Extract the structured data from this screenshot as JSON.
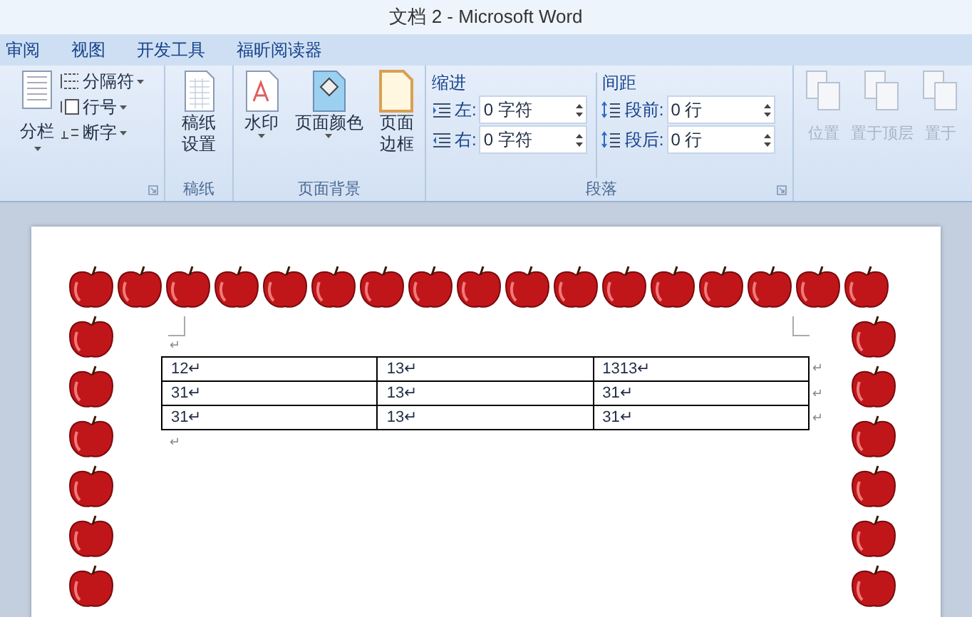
{
  "window": {
    "title": "文档 2 - Microsoft Word"
  },
  "tabs": [
    {
      "label": "审阅",
      "selected": false
    },
    {
      "label": "视图",
      "selected": false
    },
    {
      "label": "开发工具",
      "selected": false
    },
    {
      "label": "福昕阅读器",
      "selected": false
    }
  ],
  "ribbon": {
    "columns_group": {
      "large_button": {
        "label": "分栏",
        "dropdown": true
      },
      "small_buttons": [
        {
          "label": "分隔符",
          "dropdown": true,
          "kind": "breaks"
        },
        {
          "label": "行号",
          "dropdown": true,
          "kind": "line_numbers"
        },
        {
          "label": "断字",
          "dropdown": true,
          "kind": "hyphenation"
        }
      ]
    },
    "manuscript_group": {
      "label": "稿纸",
      "button": {
        "lines": [
          "稿纸",
          "设置"
        ]
      }
    },
    "background_group": {
      "label": "页面背景",
      "buttons": [
        {
          "kind": "watermark",
          "lines": [
            "水印"
          ],
          "dropdown": true
        },
        {
          "kind": "page_color",
          "lines": [
            "页面颜色"
          ],
          "dropdown": true
        },
        {
          "kind": "page_border",
          "lines": [
            "页面",
            "边框"
          ],
          "dropdown": false
        }
      ]
    },
    "paragraph_group": {
      "label": "段落",
      "sections": [
        {
          "heading": "缩进",
          "fields": [
            {
              "kind": "left",
              "label": "左:",
              "value": "0 字符"
            },
            {
              "kind": "right",
              "label": "右:",
              "value": "0 字符"
            }
          ]
        },
        {
          "heading": "间距",
          "fields": [
            {
              "kind": "before",
              "label": "段前:",
              "value": "0 行"
            },
            {
              "kind": "after",
              "label": "段后:",
              "value": "0 行"
            }
          ]
        }
      ]
    },
    "arrange_group": {
      "buttons": [
        {
          "label": "位置",
          "disabled": true
        },
        {
          "label": "置于顶层",
          "disabled": true
        },
        {
          "label": "置于",
          "disabled": true
        }
      ]
    }
  },
  "document": {
    "mark_before": "↵",
    "table": {
      "rows": [
        {
          "cells": [
            "12↵",
            "13↵",
            "1313↵"
          ],
          "end_mark": "↵"
        },
        {
          "cells": [
            "31↵",
            "13↵",
            "31↵"
          ],
          "end_mark": "↵"
        },
        {
          "cells": [
            "31↵",
            "13↵",
            "31↵"
          ],
          "end_mark": "↵"
        }
      ]
    },
    "mark_after": "↵"
  }
}
